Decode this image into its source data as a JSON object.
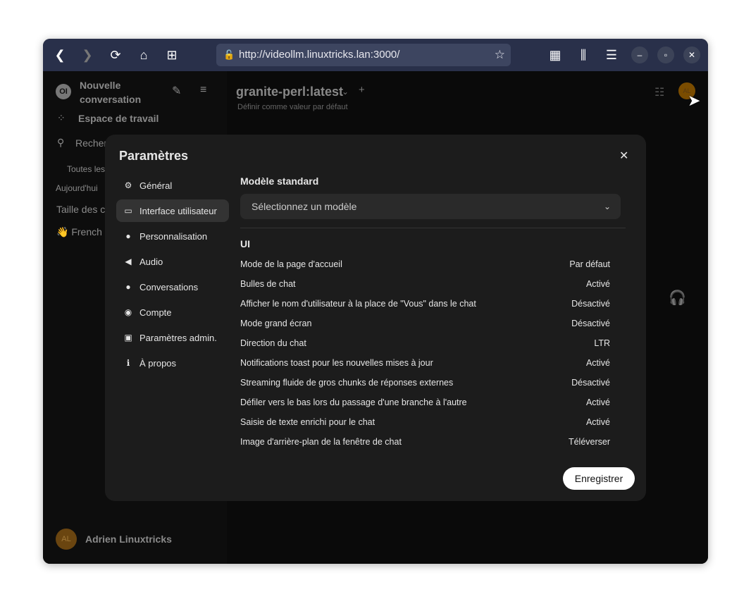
{
  "browser": {
    "url": "http://videollm.linuxtricks.lan:3000/"
  },
  "sidebar": {
    "new_chat": "Nouvelle conversation",
    "workspace": "Espace de travail",
    "search": "Recherche",
    "all": "Toutes les",
    "today": "Aujourd'hui",
    "chats": [
      "Taille des c",
      "👋 French"
    ],
    "user_initials": "AL",
    "user_name": "Adrien Linuxtricks"
  },
  "main": {
    "model": "granite-perl:latest",
    "set_default": "Définir comme valeur par défaut",
    "avatar": "AL"
  },
  "modal": {
    "title": "Paramètres",
    "nav": [
      {
        "label": "Général",
        "icon": "gear-icon",
        "glyph": "⚙"
      },
      {
        "label": "Interface utilisateur",
        "icon": "monitor-icon",
        "glyph": "▭"
      },
      {
        "label": "Personnalisation",
        "icon": "user-icon",
        "glyph": "👤"
      },
      {
        "label": "Audio",
        "icon": "speaker-icon",
        "glyph": "🔈"
      },
      {
        "label": "Conversations",
        "icon": "chat-bubble-icon",
        "glyph": "💬"
      },
      {
        "label": "Compte",
        "icon": "account-icon",
        "glyph": "◉"
      },
      {
        "label": "Paramètres admin.",
        "icon": "admin-card-icon",
        "glyph": "▣"
      },
      {
        "label": "À propos",
        "icon": "info-icon",
        "glyph": "ℹ"
      }
    ],
    "active_nav": "Interface utilisateur",
    "default_model_heading": "Modèle standard",
    "model_select_placeholder": "Sélectionnez un modèle",
    "ui_heading": "UI",
    "settings": [
      {
        "label": "Mode de la page d'accueil",
        "value": "Par défaut"
      },
      {
        "label": "Bulles de chat",
        "value": "Activé"
      },
      {
        "label": "Afficher le nom d'utilisateur à la place de \"Vous\" dans le chat",
        "value": "Désactivé"
      },
      {
        "label": "Mode grand écran",
        "value": "Désactivé"
      },
      {
        "label": "Direction du chat",
        "value": "LTR"
      },
      {
        "label": "Notifications toast pour les nouvelles mises à jour",
        "value": "Activé"
      },
      {
        "label": "Streaming fluide de gros chunks de réponses externes",
        "value": "Désactivé"
      },
      {
        "label": "Défiler vers le bas lors du passage d'une branche à l'autre",
        "value": "Activé"
      },
      {
        "label": "Saisie de texte enrichi pour le chat",
        "value": "Activé"
      },
      {
        "label": "Image d'arrière-plan de la fenêtre de chat",
        "value": "Téléverser"
      }
    ],
    "save": "Enregistrer"
  }
}
